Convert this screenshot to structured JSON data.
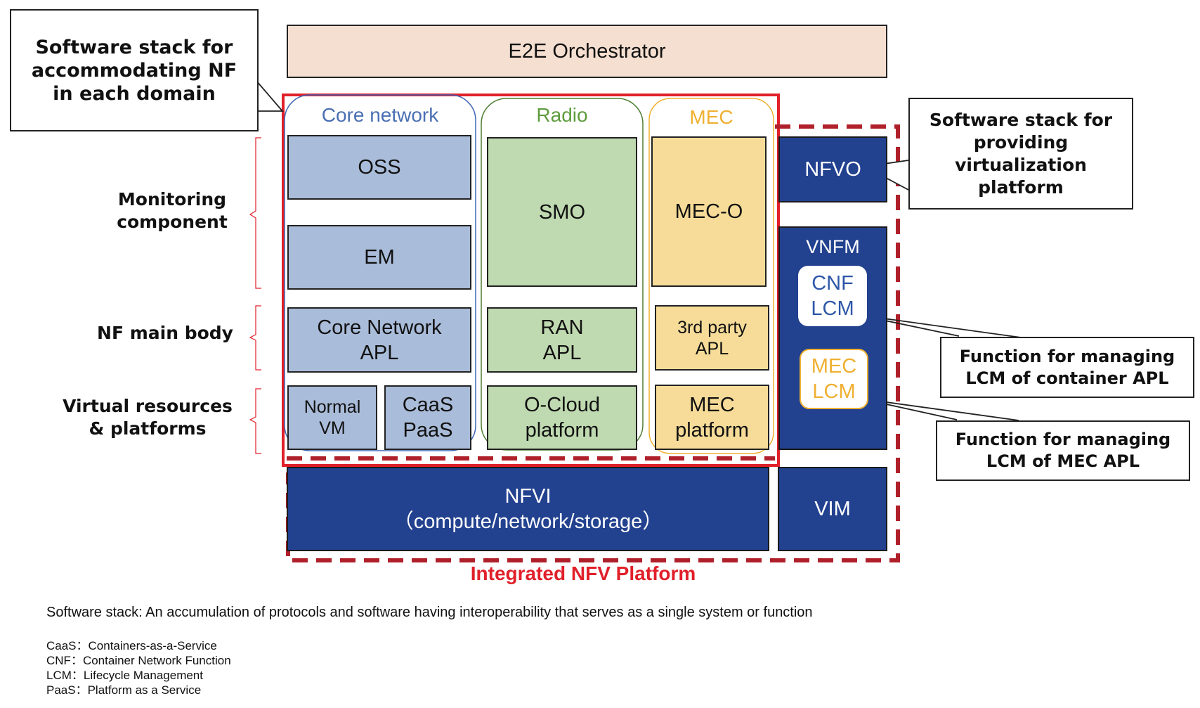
{
  "orchestrator": {
    "label": "E2E Orchestrator"
  },
  "callouts": {
    "nf_stack": [
      "Software stack for",
      "accommodating NF",
      "in each domain"
    ],
    "virt_stack": [
      "Software stack for",
      "providing virtualization",
      "platform"
    ],
    "cnf_lcm_fn": [
      "Function for managing",
      "LCM of container APL"
    ],
    "mec_lcm_fn": [
      "Function for managing",
      "LCM of MEC APL"
    ]
  },
  "layers": {
    "monitoring": [
      "Monitoring",
      "component"
    ],
    "nf_main": [
      "NF main body"
    ],
    "virtual": [
      "Virtual resources",
      "& platforms"
    ]
  },
  "domains": {
    "core": {
      "title": "Core network",
      "color": "#4a6fb3",
      "oss": "OSS",
      "em": "EM",
      "apl": [
        "Core Network",
        "APL"
      ],
      "vm": [
        "Normal",
        "VM"
      ],
      "caas": [
        "CaaS",
        "PaaS"
      ]
    },
    "radio": {
      "title": "Radio",
      "color": "#5e9c3d",
      "smo": "SMO",
      "apl": [
        "RAN",
        "APL"
      ],
      "platform": [
        "O-Cloud",
        "platform"
      ]
    },
    "mec": {
      "title": "MEC",
      "color": "#efb032",
      "meco": "MEC-O",
      "apl": [
        "3rd party",
        "APL"
      ],
      "platform": [
        "MEC",
        "platform"
      ]
    }
  },
  "nfv": {
    "nfvo": "NFVO",
    "vnfm": "VNFM",
    "cnf_lcm": [
      "CNF",
      "LCM"
    ],
    "mec_lcm": [
      "MEC",
      "LCM"
    ],
    "nfvi": [
      "NFVI",
      "（compute/network/storage）"
    ],
    "vim": "VIM",
    "platform_label": "Integrated NFV Platform"
  },
  "colors": {
    "red": "#e0202a",
    "dark_red": "#b0202a",
    "navy": "#22418f",
    "orchestrator_bg": "#f5dfd0"
  },
  "footnote": {
    "definition": "Software stack: An accumulation of protocols and software having interoperability that serves as a single system or function",
    "abbreviations": [
      "CaaS：Containers-as-a-Service",
      "CNF：Container Network Function",
      "LCM：Lifecycle Management",
      "PaaS：Platform as a Service"
    ]
  }
}
